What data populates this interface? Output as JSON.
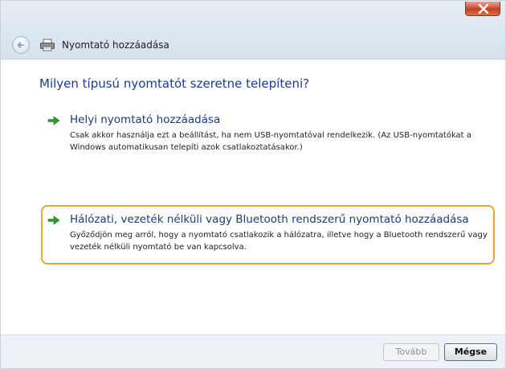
{
  "window": {
    "title": "Nyomtató hozzáadása"
  },
  "main": {
    "heading": "Milyen típusú nyomtatót szeretne telepíteni?",
    "options": [
      {
        "label": "Helyi nyomtató hozzáadása",
        "description": "Csak akkor használja ezt a beállítást, ha nem USB-nyomtatóval rendelkezik. (Az USB-nyomtatókat a Windows automatikusan telepíti azok csatlakoztatásakor.)"
      },
      {
        "label": "Hálózati, vezeték nélküli vagy Bluetooth rendszerű nyomtató hozzáadása",
        "description": "Győződjön meg arról, hogy a nyomtató csatlakozik a hálózatra, illetve hogy a Bluetooth rendszerű vagy vezeték nélküli nyomtató be van kapcsolva."
      }
    ]
  },
  "footer": {
    "next_label": "Tovább",
    "cancel_label": "Mégse"
  },
  "colors": {
    "heading": "#1f3a8a",
    "option_label": "#1e3a78",
    "highlight_border": "#e8a339",
    "arrow": "#2e9d2e"
  }
}
